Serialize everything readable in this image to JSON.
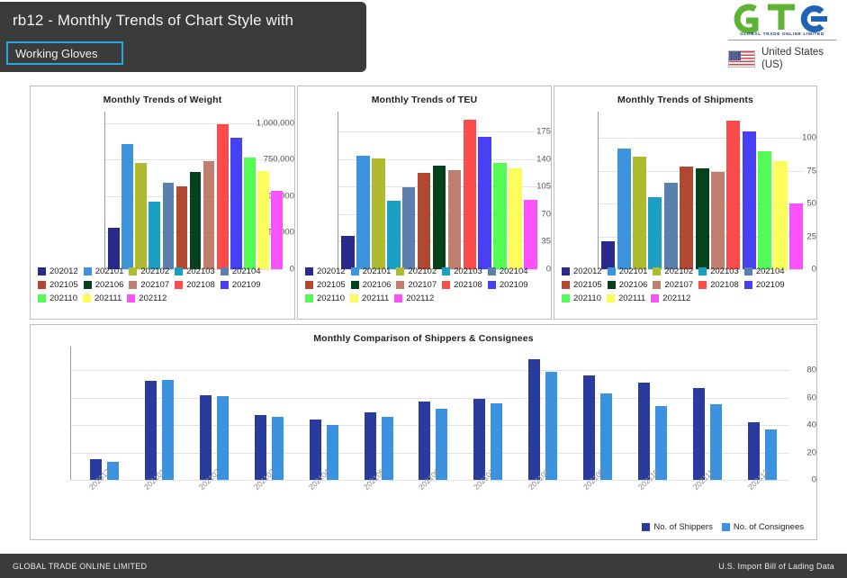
{
  "header": {
    "title": "rb12 - Monthly Trends of Chart Style with",
    "chip_value": "Working Gloves",
    "brand_name": "GTO",
    "brand_tagline": "GLOBAL  TRADE  ONLINE  LIMITED",
    "country": "United States (US)",
    "country_line1": "United States",
    "country_line2": "(US)"
  },
  "footer": {
    "left": "GLOBAL TRADE ONLINE LIMITED",
    "right": "U.S. Import Bill of Lading Data"
  },
  "palette": {
    "202012": "#2a2a8c",
    "202101": "#3c94dd",
    "202102": "#b0ba2e",
    "202103": "#1aa0c4",
    "202104": "#5a80ad",
    "202105": "#b0492f",
    "202106": "#07421f",
    "202107": "#c07f6e",
    "202108": "#fc4b4b",
    "202109": "#4840f5",
    "202110": "#55fb55",
    "202111": "#fdfd59",
    "202112": "#fb51fb",
    "shippers": "#2a3b9e",
    "consignees": "#3b92e0"
  },
  "chart_data": [
    {
      "type": "bar",
      "title": "Monthly Trends of Weight",
      "xlabel": "",
      "ylabel": "",
      "categories": [
        "202012",
        "202101",
        "202102",
        "202103",
        "202104",
        "202105",
        "202106",
        "202107",
        "202108",
        "202109",
        "202110",
        "202111",
        "202112"
      ],
      "values": [
        285000,
        860000,
        730000,
        460000,
        590000,
        565000,
        665000,
        740000,
        995000,
        900000,
        765000,
        675000,
        540000
      ],
      "yticks": [
        "0",
        "250,000",
        "500,000",
        "750,000",
        "1,000,000"
      ],
      "ytick_values": [
        0,
        250000,
        500000,
        750000,
        1000000
      ],
      "ylim": [
        0,
        1080000
      ],
      "grid": true,
      "legend_position": "bottom"
    },
    {
      "type": "bar",
      "title": "Monthly Trends of TEU",
      "xlabel": "",
      "ylabel": "",
      "categories": [
        "202012",
        "202101",
        "202102",
        "202103",
        "202104",
        "202105",
        "202106",
        "202107",
        "202108",
        "202109",
        "202110",
        "202111",
        "202112"
      ],
      "values": [
        42,
        144,
        141,
        87,
        104,
        122,
        132,
        126,
        190,
        168,
        135,
        128,
        88
      ],
      "yticks": [
        "0",
        "35",
        "70",
        "105",
        "140",
        "175"
      ],
      "ytick_values": [
        0,
        35,
        70,
        105,
        140,
        175
      ],
      "ylim": [
        0,
        200
      ],
      "grid": true,
      "legend_position": "bottom"
    },
    {
      "type": "bar",
      "title": "Monthly Trends of Shipments",
      "xlabel": "",
      "ylabel": "",
      "categories": [
        "202012",
        "202101",
        "202102",
        "202103",
        "202104",
        "202105",
        "202106",
        "202107",
        "202108",
        "202109",
        "202110",
        "202111",
        "202112"
      ],
      "values": [
        21,
        92,
        86,
        55,
        66,
        78,
        77,
        74,
        113,
        105,
        90,
        82,
        50
      ],
      "yticks": [
        "0",
        "25",
        "50",
        "75",
        "100"
      ],
      "ytick_values": [
        0,
        25,
        50,
        75,
        100
      ],
      "ylim": [
        0,
        120
      ],
      "grid": true,
      "legend_position": "bottom"
    },
    {
      "type": "bar",
      "title": "Monthly Comparison of Shippers & Consignees",
      "xlabel": "",
      "ylabel": "",
      "categories": [
        "202012",
        "202101",
        "202102",
        "202103",
        "202104",
        "202105",
        "202106",
        "202107",
        "202108",
        "202109",
        "202110",
        "202111",
        "202112"
      ],
      "series": [
        {
          "name": "No. of Shippers",
          "values": [
            15,
            72,
            62,
            47,
            44,
            49,
            57,
            59,
            88,
            76,
            71,
            67,
            42
          ]
        },
        {
          "name": "No. of Consignees",
          "values": [
            13,
            73,
            61,
            46,
            40,
            46,
            52,
            56,
            79,
            63,
            54,
            55,
            37
          ]
        }
      ],
      "yticks": [
        "0",
        "20",
        "40",
        "60",
        "80"
      ],
      "ytick_values": [
        0,
        20,
        40,
        60,
        80
      ],
      "ylim": [
        0,
        92
      ],
      "grid": true,
      "legend_position": "bottom-right"
    }
  ]
}
